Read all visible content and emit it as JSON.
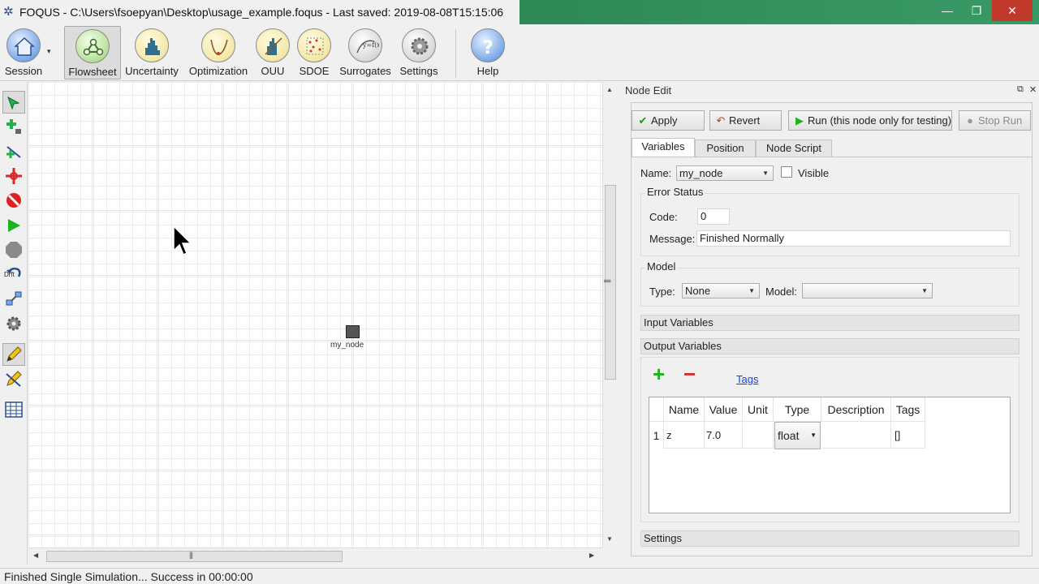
{
  "window": {
    "title": "FOQUS - C:\\Users\\fsoepyan\\Desktop\\usage_example.foqus - Last saved: 2019-08-08T15:15:06",
    "app_icon": "foqus-logo-icon",
    "controls": {
      "minimize": "—",
      "maximize": "❐",
      "close": "✕"
    }
  },
  "toolbar": {
    "items": [
      {
        "label": "Session",
        "icon": "house-icon"
      },
      {
        "label": "Flowsheet",
        "icon": "flowsheet-nodes-icon",
        "active": true
      },
      {
        "label": "Uncertainty",
        "icon": "histogram-icon"
      },
      {
        "label": "Optimization",
        "icon": "curve-minimum-icon"
      },
      {
        "label": "OUU",
        "icon": "histogram-curve-icon"
      },
      {
        "label": "SDOE",
        "icon": "scatter-design-icon"
      },
      {
        "label": "Surrogates",
        "icon": "yfx-icon"
      },
      {
        "label": "Settings",
        "icon": "gear-icon"
      },
      {
        "label": "Help",
        "icon": "help-question-icon"
      }
    ],
    "session_dropdown": "▾"
  },
  "tools": {
    "drift_label": "Drft",
    "icons": [
      "select-arrow-icon",
      "add-node-icon",
      "add-edge-icon",
      "center-icon",
      "stop-icon",
      "run-icon",
      "stop-octagon-icon",
      "undo-icon",
      "connect-icon",
      "settings-gear-icon",
      "edit-pencil-icon",
      "edit-pencil-alt-icon",
      "table-icon"
    ]
  },
  "canvas": {
    "node_label": "my_node",
    "vscroll_grip": "|||",
    "hscroll_grip": "|||"
  },
  "dock": {
    "title": "Node Edit",
    "float_icon": "⧉",
    "close_icon": "✕",
    "buttons": {
      "apply": "Apply",
      "revert": "Revert",
      "run": "Run (this node only for testing)",
      "stop": "Stop Run"
    },
    "tabs": [
      "Variables",
      "Position",
      "Node Script"
    ],
    "name_label": "Name:",
    "name_value": "my_node",
    "visible_label": "Visible",
    "error_status": {
      "title": "Error Status",
      "code_label": "Code:",
      "code_value": "0",
      "message_label": "Message:",
      "message_value": "Finished Normally"
    },
    "model": {
      "title": "Model",
      "type_label": "Type:",
      "type_value": "None",
      "model_label": "Model:",
      "model_value": ""
    },
    "sections": {
      "input": "Input Variables",
      "output": "Output Variables",
      "settings": "Settings"
    },
    "output_vars": {
      "add": "+",
      "remove": "−",
      "tags_link": "Tags",
      "columns": [
        "Name",
        "Value",
        "Unit",
        "Type",
        "Description",
        "Tags"
      ],
      "rows": [
        {
          "index": "1",
          "name": "z",
          "value": "7.0",
          "unit": "",
          "type": "float",
          "description": "",
          "tags": "[]"
        }
      ]
    }
  },
  "status": {
    "text": "Finished Single Simulation... Success in 00:00:00"
  },
  "colors": {
    "titlebar_green": "#2e8b57",
    "link_blue": "#1a3fd6",
    "close_red": "#c0392b",
    "run_green": "#1db31d"
  }
}
